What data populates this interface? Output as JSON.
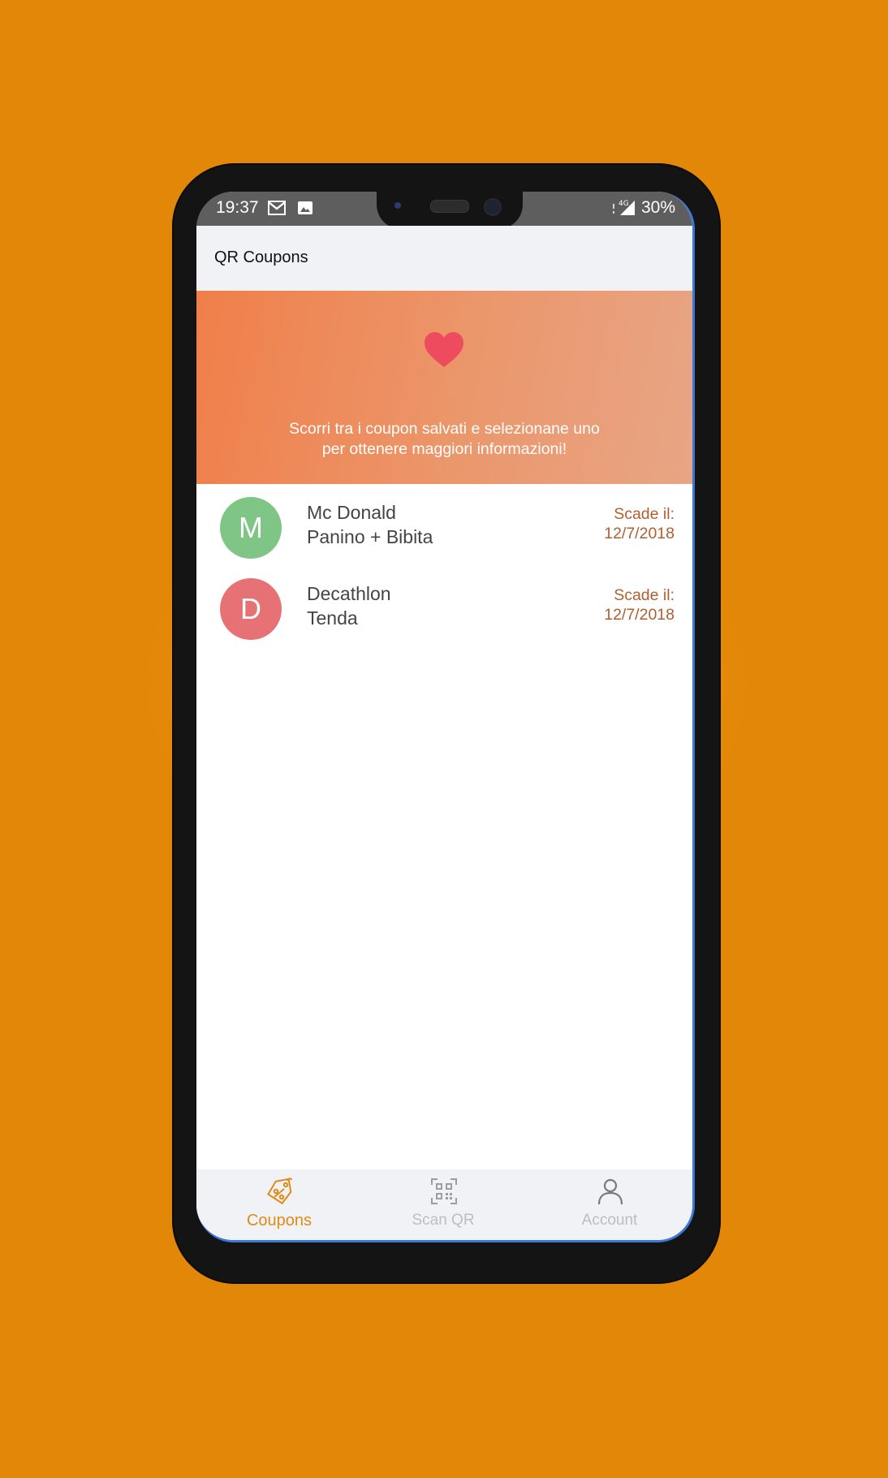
{
  "status_bar": {
    "time": "19:37",
    "network": "4G",
    "battery": "30%"
  },
  "app": {
    "title": "QR Coupons"
  },
  "banner": {
    "icon": "heart-icon",
    "message_line1": "Scorri tra i coupon salvati e selezionane uno",
    "message_line2": "per ottenere maggiori informazioni!"
  },
  "coupons": [
    {
      "initial": "M",
      "brand": "Mc Donald",
      "offer": "Panino + Bibita",
      "expiry_label": "Scade il:",
      "expiry_date": "12/7/2018",
      "avatar_color": "#7fc585"
    },
    {
      "initial": "D",
      "brand": "Decathlon",
      "offer": "Tenda",
      "expiry_label": "Scade il:",
      "expiry_date": "12/7/2018",
      "avatar_color": "#e67275"
    }
  ],
  "bottom_nav": {
    "items": [
      {
        "label": "Coupons",
        "icon": "coupon-tag-icon",
        "active": true
      },
      {
        "label": "Scan QR",
        "icon": "qr-scan-icon",
        "active": false
      },
      {
        "label": "Account",
        "icon": "person-icon",
        "active": false
      }
    ]
  },
  "colors": {
    "background": "#e38708",
    "accent": "#e18a16",
    "banner_start": "#f07f4a",
    "banner_end": "#e8a584",
    "expiry_text": "#b06030"
  }
}
